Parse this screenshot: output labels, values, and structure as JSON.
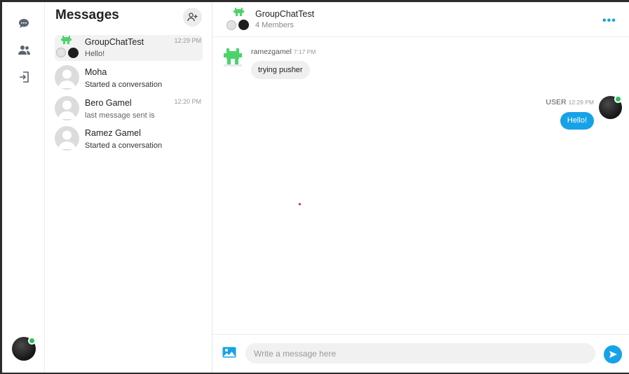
{
  "sidebar": {
    "icons": [
      "chat-icon",
      "users-icon",
      "logout-icon"
    ]
  },
  "conversations": {
    "title": "Messages",
    "items": [
      {
        "name": "GroupChatTest",
        "last": "Hello!",
        "time": "12:29 PM"
      },
      {
        "name": "Moha",
        "last": "Started a conversation",
        "time": ""
      },
      {
        "name": "Bero Gamel",
        "last": "last message sent is",
        "time": "12:20 PM"
      },
      {
        "name": "Ramez Gamel",
        "last": "Started a conversation",
        "time": ""
      }
    ]
  },
  "chat": {
    "title": "GroupChatTest",
    "subtitle": "4 Members",
    "messages": [
      {
        "sender": "ramezgamel",
        "time": "7:17 PM",
        "text": "trying pusher"
      },
      {
        "sender": "USER",
        "time": "12:29 PM",
        "text": "Hello!"
      }
    ]
  },
  "composer": {
    "placeholder": "Write a message here"
  },
  "colors": {
    "accent": "#17a2e8",
    "online": "#22c55e",
    "groupAvatar": "#4cd46b"
  }
}
